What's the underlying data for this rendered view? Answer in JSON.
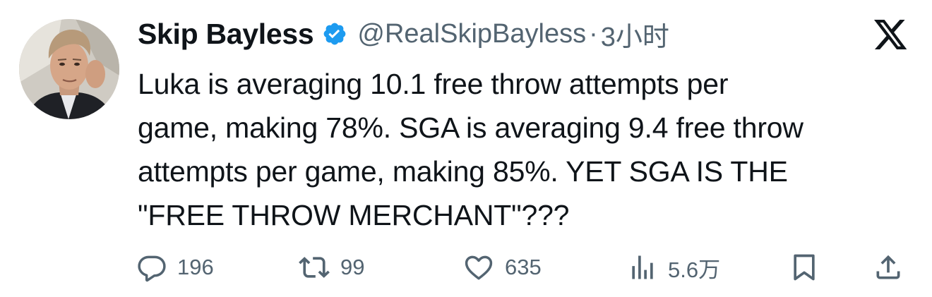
{
  "author": {
    "display_name": "Skip Bayless",
    "handle": "@RealSkipBayless",
    "separator": "·",
    "time": "3小时",
    "verified": true,
    "verified_color": "#1d9bf0"
  },
  "tweet": {
    "text": "Luka is averaging 10.1 free throw attempts per\ngame, making 78%. SGA is averaging 9.4 free throw\nattempts per game, making 85%. YET SGA IS THE\n\"FREE THROW MERCHANT\"???"
  },
  "actions": {
    "reply": {
      "icon": "reply-icon",
      "count": "196"
    },
    "retweet": {
      "icon": "retweet-icon",
      "count": "99"
    },
    "like": {
      "icon": "heart-icon",
      "count": "635"
    },
    "views": {
      "icon": "views-icon",
      "count": "5.6万"
    },
    "bookmark": {
      "icon": "bookmark-icon"
    },
    "share": {
      "icon": "share-icon"
    }
  },
  "branding": {
    "logo": "x-logo-icon"
  },
  "colors": {
    "text": "#0f1419",
    "secondary": "#536471",
    "accent": "#1d9bf0"
  }
}
